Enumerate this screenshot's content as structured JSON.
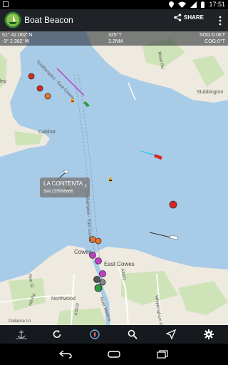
{
  "status_bar": {
    "time": "17:51",
    "icons": [
      "location-icon",
      "wifi-icon",
      "signal-icon",
      "battery-icon"
    ]
  },
  "app_bar": {
    "title": "Boat Beacon",
    "share_label": "SHARE",
    "icons": [
      "boat-beacon-logo",
      "share-icon",
      "overflow-menu-icon"
    ]
  },
  "info_bar": {
    "latitude": "51° 42.062' N",
    "longitude": "-3° 2.382' W",
    "bearing": "325°T",
    "distance": "3.2NM",
    "sog": "SOG:0.0KT",
    "cog": "COG:0°T"
  },
  "map": {
    "labels": {
      "calshot": "Calshot",
      "cowes": "Cowes",
      "east_cowes": "East Cowes",
      "northwood": "Northwood",
      "stubbington": "Stubbington",
      "moon_rd": "Moon Rd",
      "channel_upper": "Southampton - East Cowes",
      "channel_lower": "Southampton - East Cowes",
      "road_a3020": "A3020",
      "road_a3021": "A3021",
      "road_river": "River Medina",
      "road_hill": "Hill Rd",
      "road_row": "Row St",
      "road_whippingham": "Whippingham Rd",
      "road_pallance": "Pallance Ln",
      "ley": "ley"
    },
    "vessel_popup": {
      "name": "LA CONTENTA",
      "detail": "Sail 235096666",
      "chevron": "›"
    },
    "colors": {
      "water": "#a8cbe8",
      "land": "#eeeae0",
      "green": "#cfe3b8",
      "red_marker": "#d7261e",
      "orange_marker": "#e8742a",
      "magenta_marker": "#c13fc7",
      "green_marker": "#2d9b3f"
    }
  },
  "bottom_toolbar": {
    "icons": [
      "anchor-icon",
      "refresh-icon",
      "compass-icon",
      "search-icon",
      "navigation-icon",
      "settings-icon"
    ]
  },
  "nav_bar": {
    "icons": [
      "back-icon",
      "home-icon",
      "recents-icon"
    ]
  }
}
